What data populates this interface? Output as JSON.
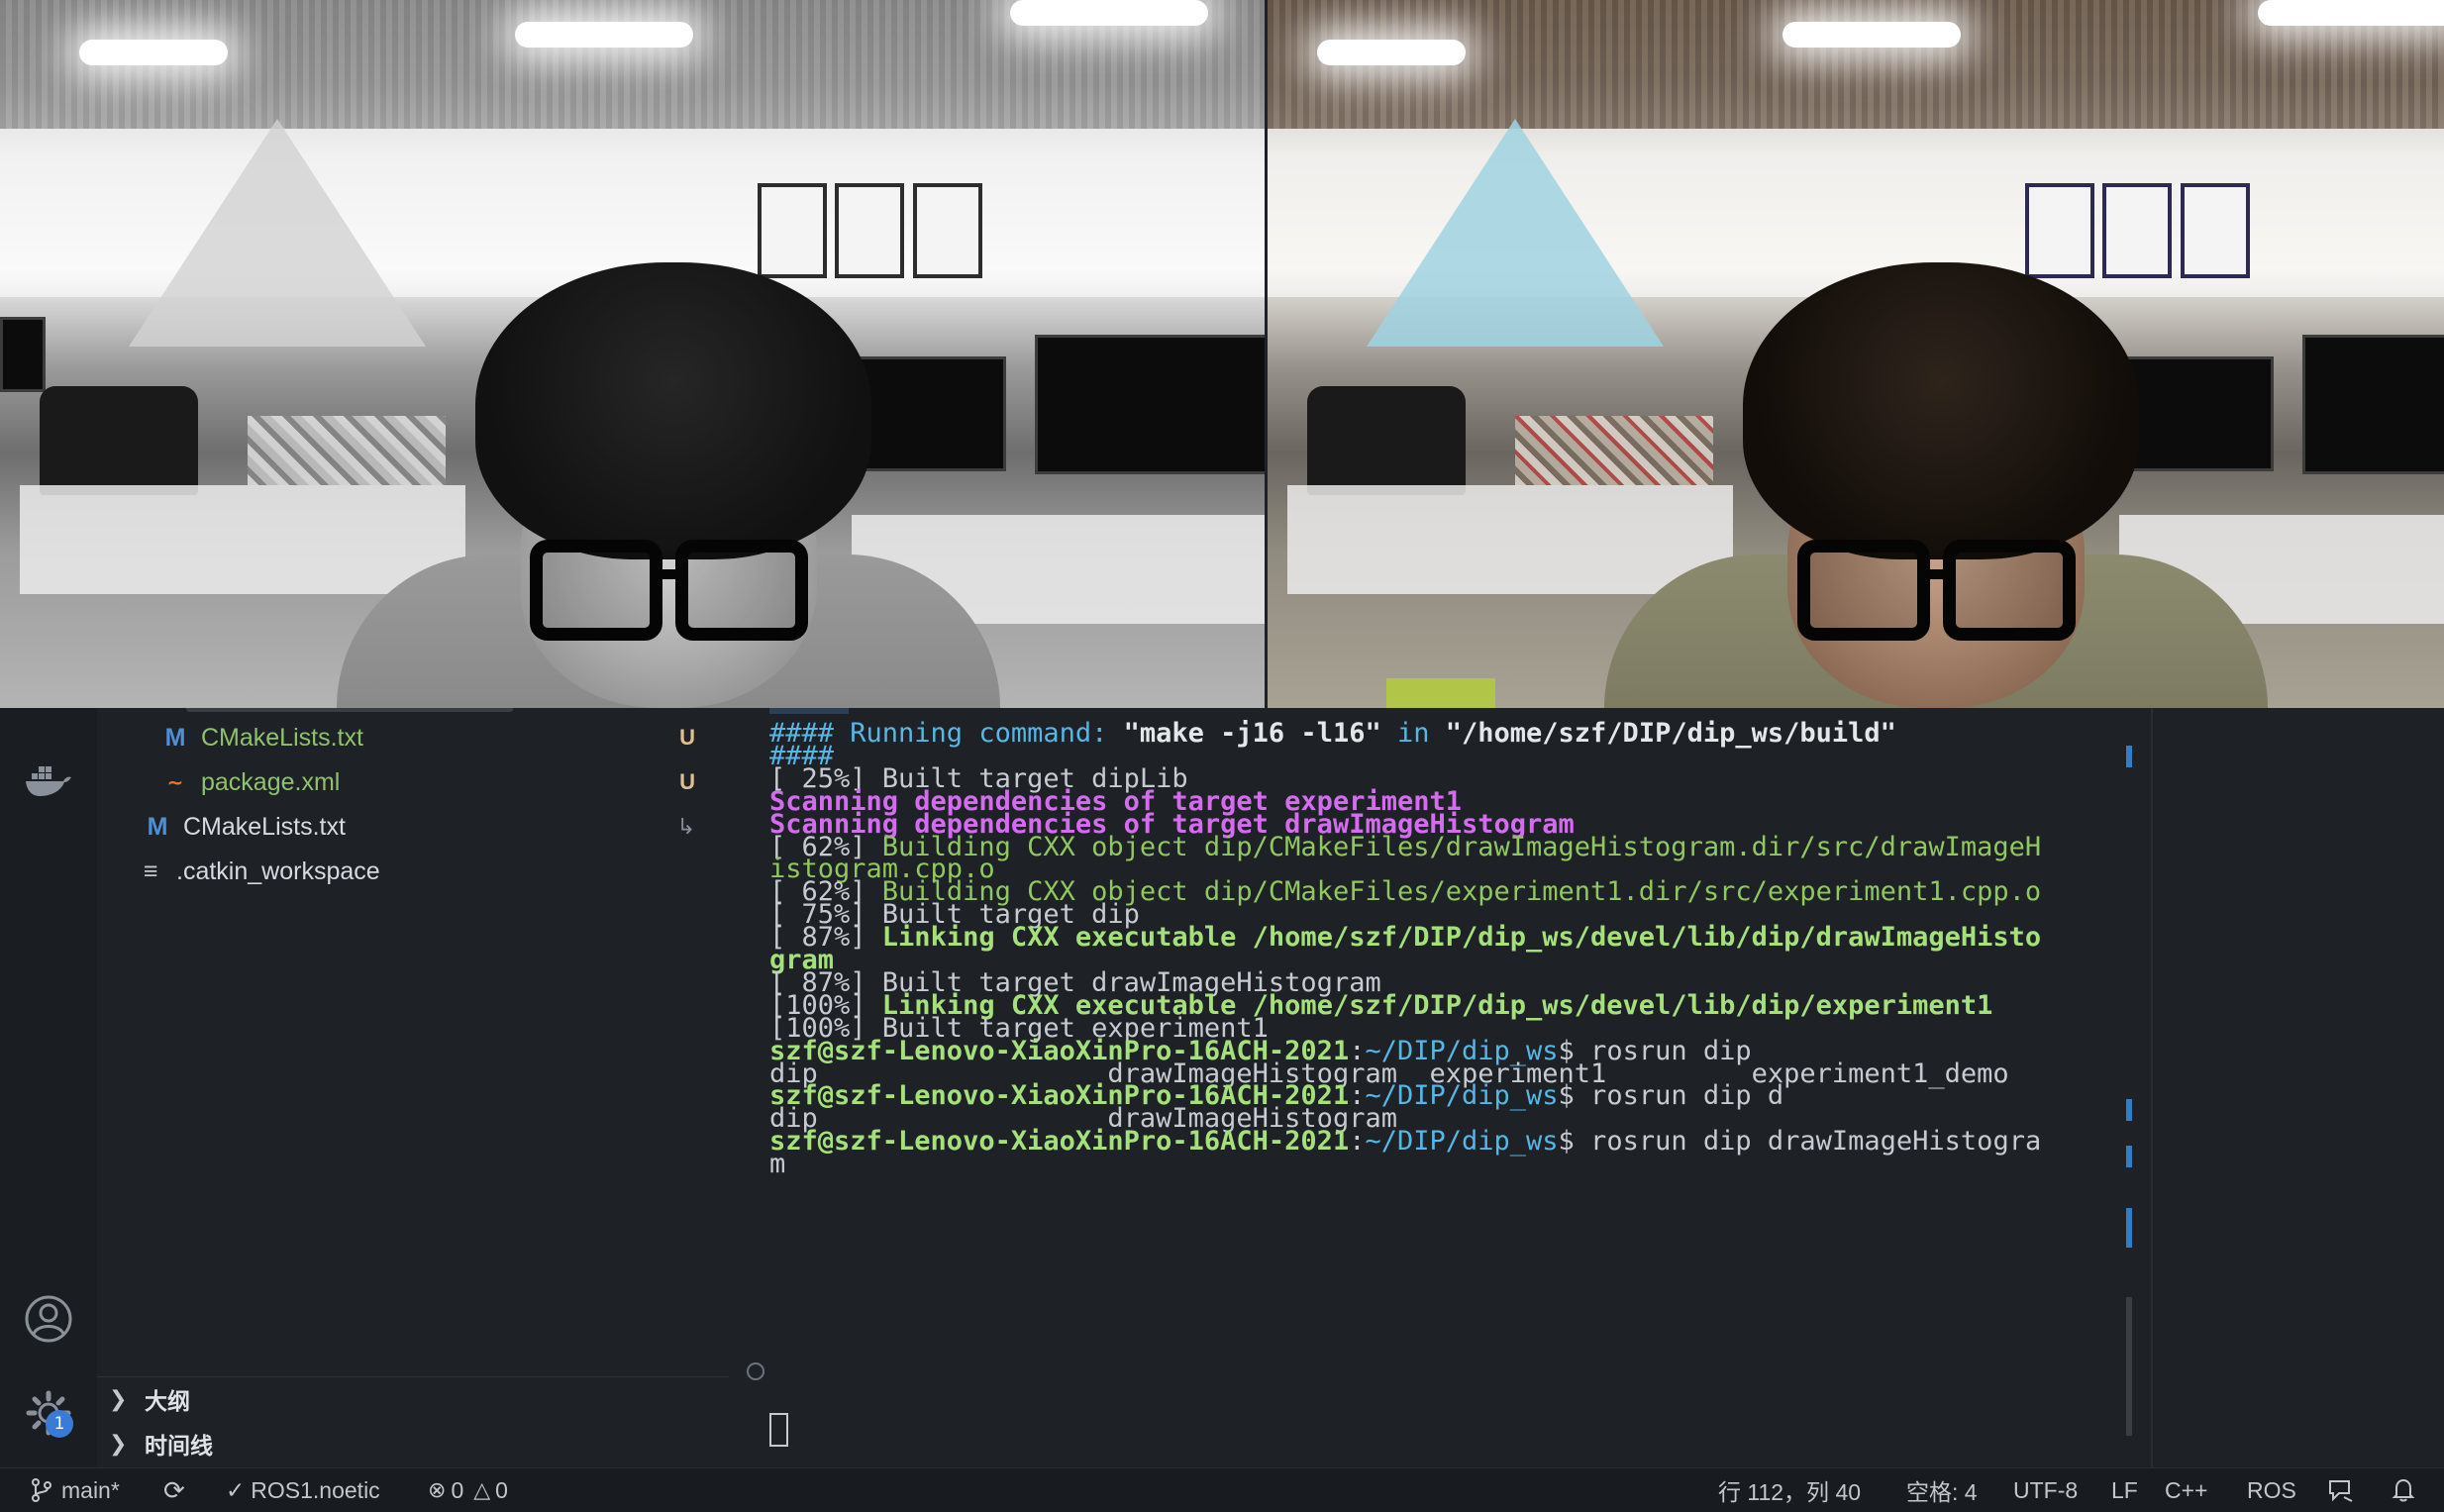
{
  "explorer": {
    "files": [
      {
        "icon": "M",
        "name": "CMakeLists.txt",
        "status": "U"
      },
      {
        "icon": "ॐ",
        "name": "package.xml",
        "status": "U"
      },
      {
        "icon": "M",
        "name": "CMakeLists.txt",
        "status": "↳"
      },
      {
        "icon": "≡",
        "name": ".catkin_workspace",
        "status": ""
      }
    ],
    "sections": [
      {
        "label": "大纲"
      },
      {
        "label": "时间线"
      }
    ]
  },
  "activity_bar": {
    "docker_icon": "docker-icon",
    "account_icon": "account-icon",
    "settings_icon": "gear-icon",
    "settings_badge": "1"
  },
  "terminal": {
    "lines": [
      {
        "segments": [
          {
            "t": "#### Running command: ",
            "c": "c-blue"
          },
          {
            "t": "\"make -j16 -l16\"",
            "c": "c-white"
          },
          {
            "t": " in ",
            "c": "c-blue"
          },
          {
            "t": "\"/home/szf/DIP/dip_ws/build\"",
            "c": "c-white"
          }
        ]
      },
      {
        "segments": [
          {
            "t": "####",
            "c": "c-blue"
          }
        ]
      },
      {
        "segments": [
          {
            "t": "[ 25%] Built target dipLib",
            "c": ""
          }
        ]
      },
      {
        "segments": [
          {
            "t": "Scanning dependencies of target experiment1",
            "c": "c-mag"
          }
        ]
      },
      {
        "segments": [
          {
            "t": "Scanning dependencies of target drawImageHistogram",
            "c": "c-mag"
          }
        ]
      },
      {
        "segments": [
          {
            "t": "[ 62%] ",
            "c": ""
          },
          {
            "t": "Building CXX object dip/CMakeFiles/drawImageHistogram.dir/src/drawImageH",
            "c": "c-green"
          }
        ]
      },
      {
        "segments": [
          {
            "t": "istogram.cpp.o",
            "c": "c-green"
          }
        ]
      },
      {
        "segments": [
          {
            "t": "[ 62%] ",
            "c": ""
          },
          {
            "t": "Building CXX object dip/CMakeFiles/experiment1.dir/src/experiment1.cpp.o",
            "c": "c-green"
          }
        ]
      },
      {
        "segments": [
          {
            "t": "[ 75%] Built target dip",
            "c": ""
          }
        ]
      },
      {
        "segments": [
          {
            "t": "[ 87%] ",
            "c": ""
          },
          {
            "t": "Linking CXX executable /home/szf/DIP/dip_ws/devel/lib/dip/drawImageHisto",
            "c": "c-gbold"
          }
        ]
      },
      {
        "segments": [
          {
            "t": "gram",
            "c": "c-gbold"
          }
        ]
      },
      {
        "segments": [
          {
            "t": "[ 87%] Built target drawImageHistogram",
            "c": ""
          }
        ]
      },
      {
        "segments": [
          {
            "t": "[100%] ",
            "c": ""
          },
          {
            "t": "Linking CXX executable /home/szf/DIP/dip_ws/devel/lib/dip/experiment1",
            "c": "c-gbold"
          }
        ]
      },
      {
        "segments": [
          {
            "t": "[100%] Built target experiment1",
            "c": ""
          }
        ]
      },
      {
        "segments": [
          {
            "t": "szf@szf-Lenovo-XiaoXinPro-16ACH-2021",
            "c": "c-gbold"
          },
          {
            "t": ":",
            "c": ""
          },
          {
            "t": "~/DIP/dip_ws",
            "c": "c-blue"
          },
          {
            "t": "$ rosrun dip",
            "c": ""
          }
        ]
      },
      {
        "segments": [
          {
            "t": "dip                  drawImageHistogram  experiment1         experiment1_demo",
            "c": ""
          }
        ]
      },
      {
        "segments": [
          {
            "t": "szf@szf-Lenovo-XiaoXinPro-16ACH-2021",
            "c": "c-gbold"
          },
          {
            "t": ":",
            "c": ""
          },
          {
            "t": "~/DIP/dip_ws",
            "c": "c-blue"
          },
          {
            "t": "$ rosrun dip d",
            "c": ""
          }
        ]
      },
      {
        "segments": [
          {
            "t": "dip                  drawImageHistogram",
            "c": ""
          }
        ]
      },
      {
        "segments": [
          {
            "t": "szf@szf-Lenovo-XiaoXinPro-16ACH-2021",
            "c": "c-gbold"
          },
          {
            "t": ":",
            "c": ""
          },
          {
            "t": "~/DIP/dip_ws",
            "c": "c-blue"
          },
          {
            "t": "$ rosrun dip drawImageHistogra",
            "c": ""
          }
        ]
      },
      {
        "segments": [
          {
            "t": "m",
            "c": ""
          }
        ]
      }
    ]
  },
  "status_bar": {
    "branch": "main*",
    "ros_env": "ROS1.noetic",
    "errors": "0",
    "warnings": "0",
    "cursor_position": "行 112，列 40",
    "indent": "空格: 4",
    "encoding": "UTF-8",
    "eol": "LF",
    "language": "C++",
    "ros": "ROS"
  },
  "colors": {
    "untracked": "#e2c08d",
    "file_green": "#8fc26c",
    "accent": "#2f7fc7"
  }
}
